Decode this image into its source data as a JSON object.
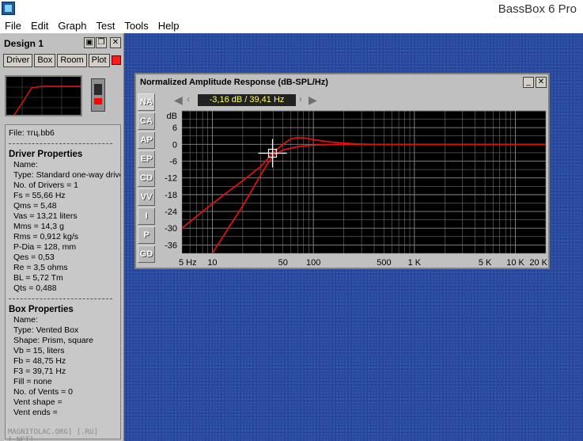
{
  "app": {
    "title": "BassBox 6 Pro",
    "watermark": "MAGNITOLA"
  },
  "menu": [
    "File",
    "Edit",
    "Graph",
    "Test",
    "Tools",
    "Help"
  ],
  "design": {
    "title": "Design 1",
    "tabs": [
      "Driver",
      "Box",
      "Room",
      "Plot"
    ],
    "file": "File: тгц.bb6",
    "driver_head": "Driver Properties",
    "driver_lines": [
      "Name:",
      "Type: Standard one-way driver",
      "No. of Drivers = 1",
      "Fs =  55,66 Hz",
      "Qms =  5,48",
      "Vas =  13,21 liters",
      "Mms =  14,3 g",
      "Rms =  0,912 kg/s",
      "P-Dia =  128, mm",
      "Qes =  0,53",
      "Re =  3,5 ohms",
      "BL =  5,72 Tm",
      "Qts =  0,488"
    ],
    "box_head": "Box Properties",
    "box_lines": [
      "Name:",
      "Type: Vented Box",
      "Shape: Prism, square",
      "Vb =  15, liters",
      "Fb =  48,75 Hz",
      "F3 =  39,71 Hz",
      "Fill = none",
      "No. of Vents = 0",
      "  Vent shape =",
      "  Vent ends ="
    ],
    "bottom_watermark": "MAGNITOLAC.ORG] [.RU] [.NET]"
  },
  "graph": {
    "title": "Normalized Amplitude Response (dB-SPL/Hz)",
    "readout": "-3,16 dB / 39,41 Hz",
    "side_tabs": [
      "NA",
      "CA",
      "AP",
      "EP",
      "CD",
      "VV",
      "I",
      "P",
      "GD"
    ],
    "active_tab": "NA",
    "colors": {
      "plot_bg": "#000000",
      "grid": "#8a8a8a",
      "curve": "#e01010"
    }
  },
  "chart_data": {
    "type": "line",
    "title": "",
    "xlabel": "",
    "ylabel": "dB",
    "xscale": "log",
    "xlim": [
      5,
      20000
    ],
    "ylim": [
      -39,
      12
    ],
    "yticks": [
      6,
      0,
      -6,
      -12,
      -18,
      -24,
      -30,
      -36
    ],
    "xticks": [
      {
        "v": 5,
        "label": "5 Hz"
      },
      {
        "v": 10,
        "label": "10"
      },
      {
        "v": 50,
        "label": "50"
      },
      {
        "v": 100,
        "label": "100"
      },
      {
        "v": 500,
        "label": "500"
      },
      {
        "v": 1000,
        "label": "1 K"
      },
      {
        "v": 5000,
        "label": "5 K"
      },
      {
        "v": 10000,
        "label": "10 K"
      },
      {
        "v": 20000,
        "label": "20 K"
      }
    ],
    "cursor": {
      "x": 39.41,
      "y": -3.16
    },
    "series": [
      {
        "values": [
          [
            5,
            -30
          ],
          [
            8,
            -24
          ],
          [
            12,
            -19
          ],
          [
            20,
            -13
          ],
          [
            30,
            -8
          ],
          [
            39.41,
            -3.16
          ],
          [
            50,
            0
          ],
          [
            60,
            2
          ],
          [
            70,
            2.4
          ],
          [
            85,
            2.2
          ],
          [
            100,
            1.7
          ],
          [
            150,
            0.8
          ],
          [
            250,
            0.2
          ],
          [
            400,
            0
          ],
          [
            20000,
            0
          ]
        ]
      },
      {
        "values": [
          [
            10,
            -39
          ],
          [
            15,
            -29
          ],
          [
            20,
            -22
          ],
          [
            25,
            -16
          ],
          [
            30,
            -11
          ],
          [
            35,
            -7
          ],
          [
            40,
            -4
          ],
          [
            50,
            -2
          ],
          [
            70,
            -0.8
          ],
          [
            100,
            -0.2
          ],
          [
            200,
            0
          ],
          [
            20000,
            0
          ]
        ]
      }
    ]
  }
}
